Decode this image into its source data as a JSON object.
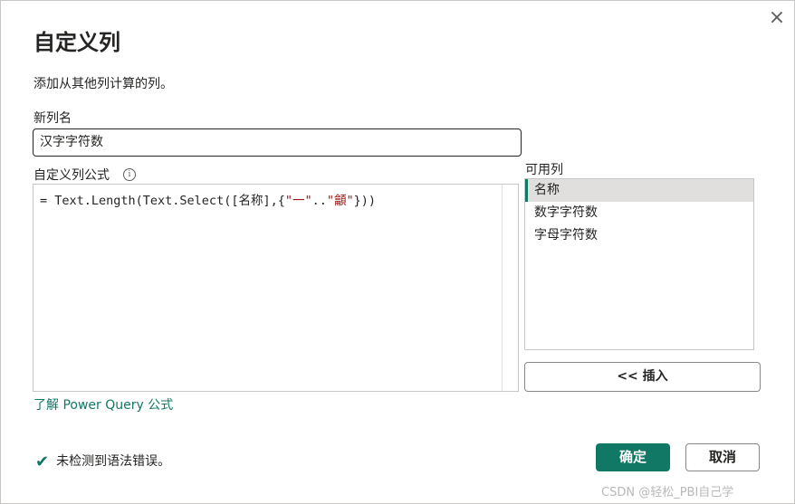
{
  "dialog": {
    "title": "自定义列",
    "description": "添加从其他列计算的列。",
    "close_glyph": "×"
  },
  "new_column": {
    "label": "新列名",
    "value": "汉字字符数"
  },
  "formula": {
    "label": "自定义列公式",
    "info_glyph": "i",
    "prefix": "= Text.Length(Text.Select([名称],{",
    "str1": "\"一\"",
    "mid": "..",
    "str2": "\"龥\"",
    "suffix": "}))"
  },
  "learn_link": "了解 Power Query 公式",
  "available_columns": {
    "label": "可用列",
    "items": [
      {
        "label": "名称",
        "selected": true
      },
      {
        "label": "数字字符数",
        "selected": false
      },
      {
        "label": "字母字符数",
        "selected": false
      }
    ]
  },
  "insert_button": "<< 插入",
  "status": {
    "icon": "check-icon",
    "text": "未检测到语法错误。"
  },
  "ok_button": "确定",
  "cancel_button": "取消",
  "watermark": "CSDN @轻松_PBI自己学",
  "colors": {
    "accent": "#117865",
    "string": "#a31515"
  }
}
